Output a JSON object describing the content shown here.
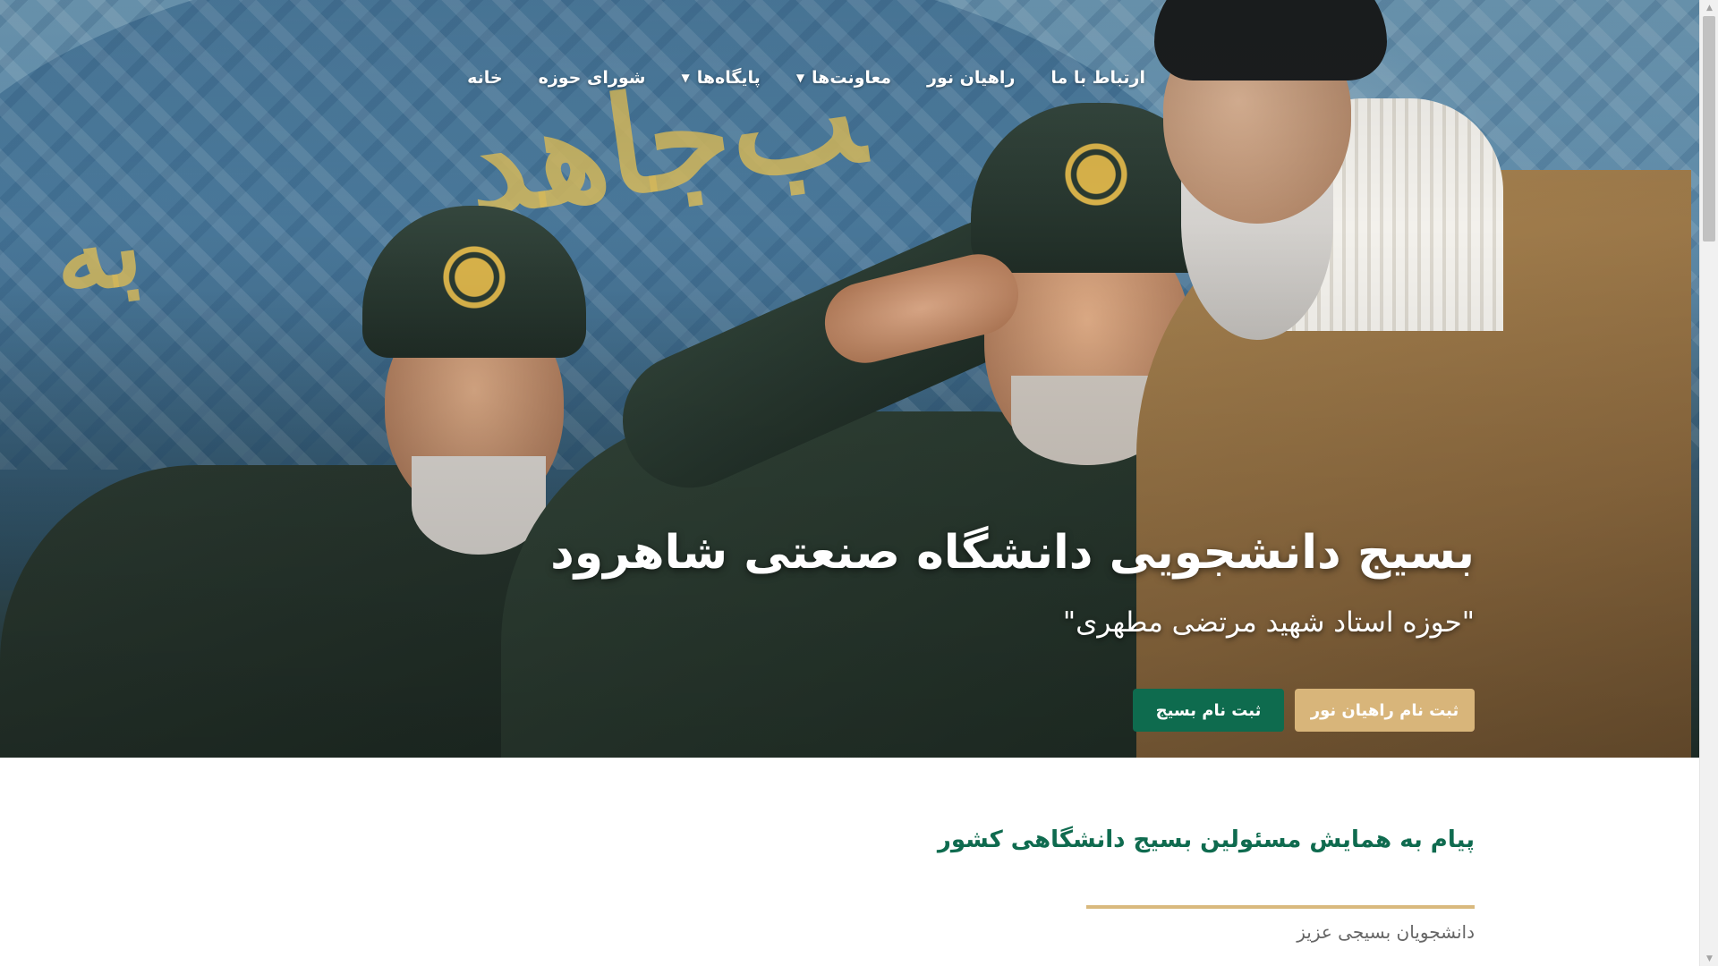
{
  "nav": {
    "items": [
      {
        "label": "خانه",
        "has_dropdown": false
      },
      {
        "label": "شورای حوزه",
        "has_dropdown": false
      },
      {
        "label": "پایگاه‌ها",
        "has_dropdown": true
      },
      {
        "label": "معاونت‌ها",
        "has_dropdown": true
      },
      {
        "label": "راهیان نور",
        "has_dropdown": false
      },
      {
        "label": "ارتباط با ما",
        "has_dropdown": false
      }
    ]
  },
  "hero": {
    "title": "بسیج دانشجویی دانشگاه صنعتی شاهرود",
    "subtitle": "\"حوزه استاد شهید مرتضی مطهری\"",
    "buttons": {
      "rahian_label": "ثبت نام راهیان نور",
      "basij_label": "ثبت نام بسیج"
    }
  },
  "content": {
    "section_title": "پیام به همایش مسئولین بسیج دانشگاهی کشور",
    "greeting": "دانشجویان بسیجی عزیز"
  },
  "colors": {
    "accent_green": "#0e6b4e",
    "accent_gold": "#d8b57a",
    "divider_gold": "#d9b97e"
  }
}
